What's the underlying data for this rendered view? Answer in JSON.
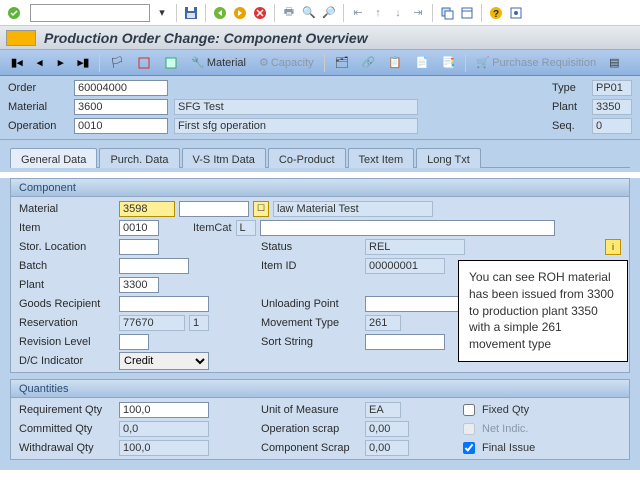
{
  "window": {
    "title": "Production Order Change: Component Overview"
  },
  "toolbar": {
    "material_btn": "Material",
    "capacity_btn": "Capacity",
    "purchreq_btn": "Purchase Requisition"
  },
  "header": {
    "order_lbl": "Order",
    "order_val": "60004000",
    "type_lbl": "Type",
    "type_val": "PP01",
    "material_lbl": "Material",
    "material_val": "3600",
    "material_desc": "SFG Test",
    "plant_lbl": "Plant",
    "plant_val": "3350",
    "operation_lbl": "Operation",
    "operation_val": "0010",
    "operation_desc": "First sfg operation",
    "seq_lbl": "Seq.",
    "seq_val": "0"
  },
  "tabs": {
    "general": "General Data",
    "purch": "Purch. Data",
    "vsitm": "V-S Itm Data",
    "coprod": "Co-Product",
    "text": "Text Item",
    "long": "Long Txt"
  },
  "component": {
    "group_title": "Component",
    "material_lbl": "Material",
    "material_val": "3598",
    "material_desc": "law Material Test",
    "item_lbl": "Item",
    "item_val": "0010",
    "itemcat_lbl": "ItemCat",
    "itemcat_val": "L",
    "storloc_lbl": "Stor. Location",
    "storloc_val": "",
    "status_lbl": "Status",
    "status_val": "REL",
    "batch_lbl": "Batch",
    "batch_val": "",
    "itemid_lbl": "Item ID",
    "itemid_val": "00000001",
    "plant_lbl": "Plant",
    "plant_val": "3300",
    "goodsrec_lbl": "Goods Recipient",
    "goodsrec_val": "",
    "unloadpt_lbl": "Unloading Point",
    "unloadpt_val": "",
    "reservation_lbl": "Reservation",
    "reservation_val": "77670",
    "reservation_pos": "1",
    "mvttype_lbl": "Movement Type",
    "mvttype_val": "261",
    "revlevel_lbl": "Revision Level",
    "revlevel_val": "",
    "sortstr_lbl": "Sort String",
    "sortstr_val": "",
    "dcind_lbl": "D/C Indicator",
    "dcind_val": "Credit"
  },
  "qty": {
    "group_title": "Quantities",
    "reqqty_lbl": "Requirement Qty",
    "reqqty_val": "100,0",
    "uom_lbl": "Unit of Measure",
    "uom_val": "EA",
    "fixed_lbl": "Fixed Qty",
    "commqty_lbl": "Committed Qty",
    "commqty_val": "0,0",
    "opscrap_lbl": "Operation scrap",
    "opscrap_val": "0,00",
    "netind_lbl": "Net Indic.",
    "withqty_lbl": "Withdrawal Qty",
    "withqty_val": "100,0",
    "compscrap_lbl": "Component Scrap",
    "compscrap_val": "0,00",
    "final_lbl": "Final Issue"
  },
  "callout": "You can see ROH material has been issued from 3300 to production plant 3350 with a simple 261 movement type"
}
